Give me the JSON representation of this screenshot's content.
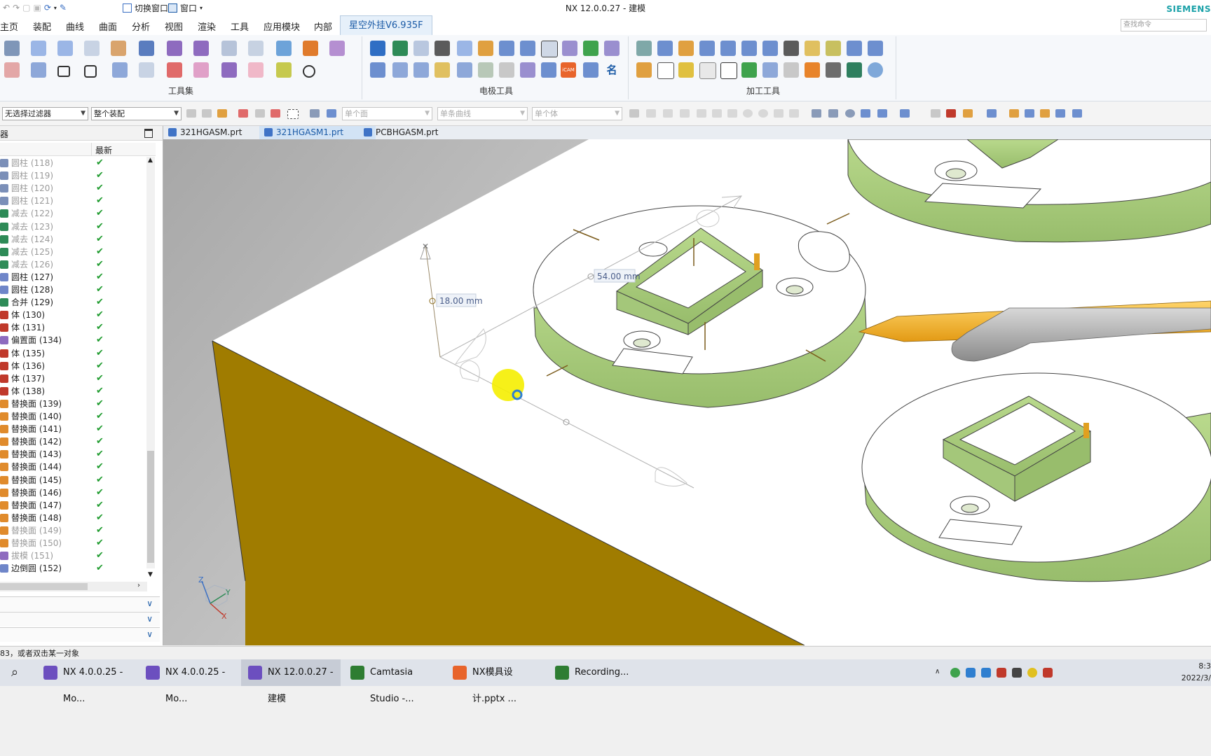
{
  "app": {
    "title": "NX 12.0.0.27 - 建模",
    "brand": "SIEMENS",
    "quick_access": {
      "switch_window": "切换窗口",
      "window": "窗口"
    }
  },
  "menu": {
    "tabs": [
      "主页",
      "装配",
      "曲线",
      "曲面",
      "分析",
      "视图",
      "渲染",
      "工具",
      "应用模块",
      "内部"
    ],
    "active_tab": "星空外挂V6.935F",
    "search_placeholder": "查找命令"
  },
  "ribbon": {
    "groups": [
      {
        "label": "工具集"
      },
      {
        "label": "电极工具"
      },
      {
        "label": "加工工具"
      }
    ],
    "icam_label": "iCAM",
    "name_label": "名"
  },
  "filterbar": {
    "type_filter": "无选择过滤器",
    "scope": "整个装配",
    "face_rule": "单个面",
    "curve_rule": "单条曲线",
    "body_rule": "单个体"
  },
  "navigator": {
    "title": "器",
    "col_latest": "最新",
    "check_mark": "✔",
    "rows": [
      {
        "name": "圆柱 (118)",
        "dim": true,
        "color": "#7b8fb8"
      },
      {
        "name": "圆柱 (119)",
        "dim": true,
        "color": "#7b8fb8"
      },
      {
        "name": "圆柱 (120)",
        "dim": true,
        "color": "#7b8fb8"
      },
      {
        "name": "圆柱 (121)",
        "dim": true,
        "color": "#7b8fb8"
      },
      {
        "name": "减去 (122)",
        "dim": true,
        "color": "#2e8b57"
      },
      {
        "name": "减去 (123)",
        "dim": true,
        "color": "#2e8b57"
      },
      {
        "name": "减去 (124)",
        "dim": true,
        "color": "#2e8b57"
      },
      {
        "name": "减去 (125)",
        "dim": true,
        "color": "#2e8b57"
      },
      {
        "name": "减去 (126)",
        "dim": true,
        "color": "#2e8b57"
      },
      {
        "name": "圆柱 (127)",
        "dim": false,
        "color": "#6f86c9"
      },
      {
        "name": "圆柱 (128)",
        "dim": false,
        "color": "#6f86c9"
      },
      {
        "name": "合并 (129)",
        "dim": false,
        "color": "#2e8b57"
      },
      {
        "name": "体 (130)",
        "dim": false,
        "color": "#c0392b"
      },
      {
        "name": "体 (131)",
        "dim": false,
        "color": "#c0392b"
      },
      {
        "name": "偏置面 (134)",
        "dim": false,
        "color": "#8e6bbf"
      },
      {
        "name": "体 (135)",
        "dim": false,
        "color": "#c0392b"
      },
      {
        "name": "体 (136)",
        "dim": false,
        "color": "#c0392b"
      },
      {
        "name": "体 (137)",
        "dim": false,
        "color": "#c0392b"
      },
      {
        "name": "体 (138)",
        "dim": false,
        "color": "#c0392b"
      },
      {
        "name": "替换面 (139)",
        "dim": false,
        "color": "#e08b2c"
      },
      {
        "name": "替换面 (140)",
        "dim": false,
        "color": "#e08b2c"
      },
      {
        "name": "替换面 (141)",
        "dim": false,
        "color": "#e08b2c"
      },
      {
        "name": "替换面 (142)",
        "dim": false,
        "color": "#e08b2c"
      },
      {
        "name": "替换面 (143)",
        "dim": false,
        "color": "#e08b2c"
      },
      {
        "name": "替换面 (144)",
        "dim": false,
        "color": "#e08b2c"
      },
      {
        "name": "替换面 (145)",
        "dim": false,
        "color": "#e08b2c"
      },
      {
        "name": "替换面 (146)",
        "dim": false,
        "color": "#e08b2c"
      },
      {
        "name": "替换面 (147)",
        "dim": false,
        "color": "#e08b2c"
      },
      {
        "name": "替换面 (148)",
        "dim": false,
        "color": "#e08b2c"
      },
      {
        "name": "替换面 (149)",
        "dim": true,
        "color": "#e08b2c"
      },
      {
        "name": "替换面 (150)",
        "dim": true,
        "color": "#e08b2c"
      },
      {
        "name": "拔模 (151)",
        "dim": true,
        "color": "#8e6bbf"
      },
      {
        "name": "边倒圆 (152)",
        "dim": false,
        "color": "#6f86c9"
      }
    ]
  },
  "doc_tabs": [
    {
      "label": "321HGASM.prt",
      "active": false
    },
    {
      "label": "321HGASM1.prt",
      "active": true
    },
    {
      "label": "PCBHGASM.prt",
      "active": false
    }
  ],
  "viewport": {
    "dim_height": "18.00 mm",
    "dim_length": "54.00 mm",
    "triad": {
      "z": "Z",
      "y": "Y",
      "x": "X"
    }
  },
  "status": {
    "prompt": "83，或者双击某一对象"
  },
  "taskbar": {
    "items": [
      {
        "label": "NX 4.0.0.25 - Mo...",
        "active": false,
        "color": "#6c4fbf"
      },
      {
        "label": "NX 4.0.0.25 - Mo...",
        "active": false,
        "color": "#6c4fbf"
      },
      {
        "label": "NX 12.0.0.27 - 建模",
        "active": true,
        "color": "#6c4fbf"
      },
      {
        "label": "Camtasia Studio -...",
        "active": false,
        "color": "#2e7d32"
      },
      {
        "label": "NX模具设计.pptx ...",
        "active": false,
        "color": "#e8642b"
      },
      {
        "label": "Recording...",
        "active": false,
        "color": "#2e7d32"
      }
    ],
    "clock_time": "8:3",
    "clock_date": "2022/3/"
  },
  "colors": {
    "part_green": "#b8d88a",
    "part_wall": "#a4c77a",
    "block_side": "#a07c00",
    "tool_orange": "#f4b12a",
    "accent": "#1a5aa6"
  }
}
